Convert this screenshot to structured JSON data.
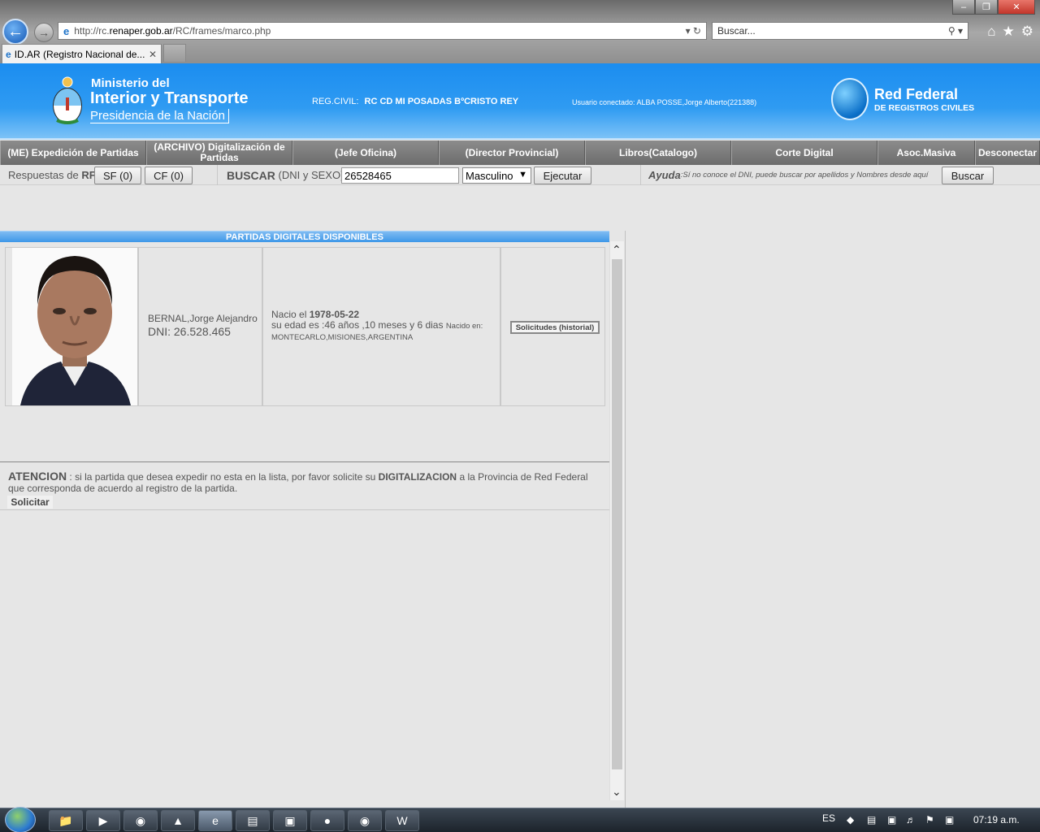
{
  "browser": {
    "url_prefix": "http://rc.",
    "url_host": "renaper.gob.ar",
    "url_path": "/RC/frames/marco.php",
    "search_placeholder": "Buscar...",
    "tab_title": "ID.AR (Registro Nacional de..."
  },
  "header": {
    "ministerio_line1": "Ministerio del",
    "ministerio_line2": "Interior y Transporte",
    "ministerio_line3": "Presidencia de la Nación",
    "regcivil_label": "REG.CIVIL:",
    "regcivil_value": "RC CD MI POSADAS BºCRISTO REY",
    "usuario": "Usuario conectado: ALBA POSSE,Jorge Alberto(221388)",
    "red_federal_title": "Red Federal",
    "red_federal_sub": "DE REGISTROS CIVILES"
  },
  "menu": [
    "(ME) Expedición de Partidas",
    "(ARCHIVO) Digitalización de Partidas",
    "(Jefe Oficina)",
    "(Director Provincial)",
    "Libros(Catalogo)",
    "Corte Digital",
    "Asoc.Masiva",
    "Desconectar"
  ],
  "toolbar": {
    "respuestas_label": "Respuestas de",
    "respuestas_rf": "RF",
    "sf_button": "SF (0)",
    "cf_button": "CF (0)",
    "buscar_label": "BUSCAR",
    "buscar_hint": "(DNI y SEXO)",
    "dni_value": "26528465",
    "sexo_value": "Masculino",
    "ejecutar_button": "Ejecutar",
    "ayuda_label": "Ayuda",
    "ayuda_text": ":Sí no conoce el DNI, puede buscar por apellidos y Nombres desde aquí",
    "buscar_button": "Buscar"
  },
  "partidas": {
    "title": "PARTIDAS DIGITALES DISPONIBLES",
    "name": "BERNAL,Jorge Alejandro",
    "dni": "DNI: 26.528.465",
    "nacio_label": "Nacio el",
    "nacio_fecha": "1978-05-22",
    "edad": "su edad es :46 años ,10 meses y 6 dias",
    "nacido_en_label": "Nacido en:",
    "nacido_en": "MONTECARLO,MISIONES,ARGENTINA",
    "solicitudes_button": "Solicitudes (historial)"
  },
  "atencion": {
    "label": "ATENCION",
    "text1": ": si la partida que desea expedir no esta en la lista, por favor solicite su",
    "digitalizacion": "DIGITALIZACION",
    "text2": "a la Provincia de Red Federal que corresponda de acuerdo al registro de la partida.",
    "solicitar_button": "Solicitar"
  },
  "taskbar": {
    "lang": "ES",
    "clock": "07:19 a.m."
  },
  "colors": {
    "header_blue": "#1b8df0",
    "menu_gray": "#7a7a7a",
    "title_bar_blue": "#3d97e8"
  }
}
